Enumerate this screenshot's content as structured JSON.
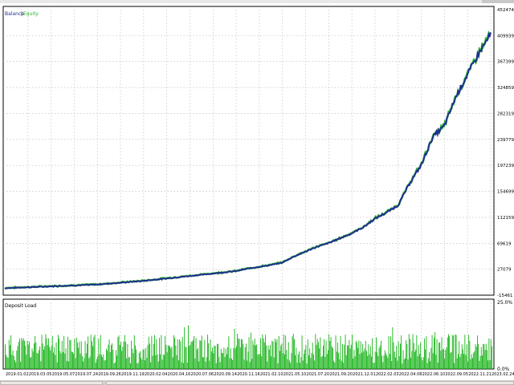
{
  "chart_data": [
    {
      "type": "line",
      "legend": [
        "Balance",
        "Equity"
      ],
      "series": [
        {
          "name": "Balance",
          "color": "#1f2f8f"
        },
        {
          "name": "Equity",
          "color": "#2db52d"
        }
      ],
      "y_tick_labels": [
        "452474",
        "409939",
        "367399",
        "324859",
        "282319",
        "239779",
        "197239",
        "154699",
        "112159",
        "69619",
        "27079",
        "-15461"
      ],
      "ylim": [
        -15461,
        452474
      ],
      "x_tick_labels": [
        "2019.01.02",
        "2019.03.05",
        "2019.05.07",
        "2019.07.24",
        "2019.09.26",
        "2019.11.19",
        "2020.02.04",
        "2020.04.16",
        "2020.07.06",
        "2020.09.14",
        "2020.11.16",
        "2021.02.10",
        "2021.05.10",
        "2021.07.20",
        "2021.09.20",
        "2021.12.01",
        "2022.02.03",
        "2022.04.08",
        "2022.06.10",
        "2022.09.05",
        "2022.11.21",
        "2023.02.24"
      ],
      "x": [
        0,
        10,
        20,
        30,
        40,
        50,
        60,
        70,
        80,
        90,
        100,
        110,
        120,
        130,
        140,
        150,
        160,
        170,
        180,
        190,
        200,
        210
      ],
      "balance": [
        -4000,
        -2500,
        -1000,
        500,
        2000,
        5000,
        8000,
        12000,
        16000,
        20000,
        24000,
        28000,
        31000,
        34000,
        38000,
        48000,
        56000,
        64000,
        70000,
        78000,
        86000,
        96000,
        110000,
        120000,
        132000,
        168000,
        198000,
        244000,
        262000,
        310000,
        346000,
        382000,
        412000
      ],
      "balance_x": [
        0,
        10,
        20,
        30,
        40,
        50,
        60,
        70,
        80,
        90,
        100,
        105,
        110,
        115,
        120,
        125,
        130,
        135,
        140,
        145,
        150,
        155,
        160,
        165,
        170,
        175,
        180,
        185,
        190,
        195,
        200,
        205,
        210
      ],
      "grid": true
    },
    {
      "type": "bar",
      "title": "Deposit Load",
      "y_tick_labels": [
        "25.0%",
        "0.0%"
      ],
      "ylim": [
        0,
        25
      ],
      "typical_range": [
        2,
        13
      ]
    }
  ]
}
